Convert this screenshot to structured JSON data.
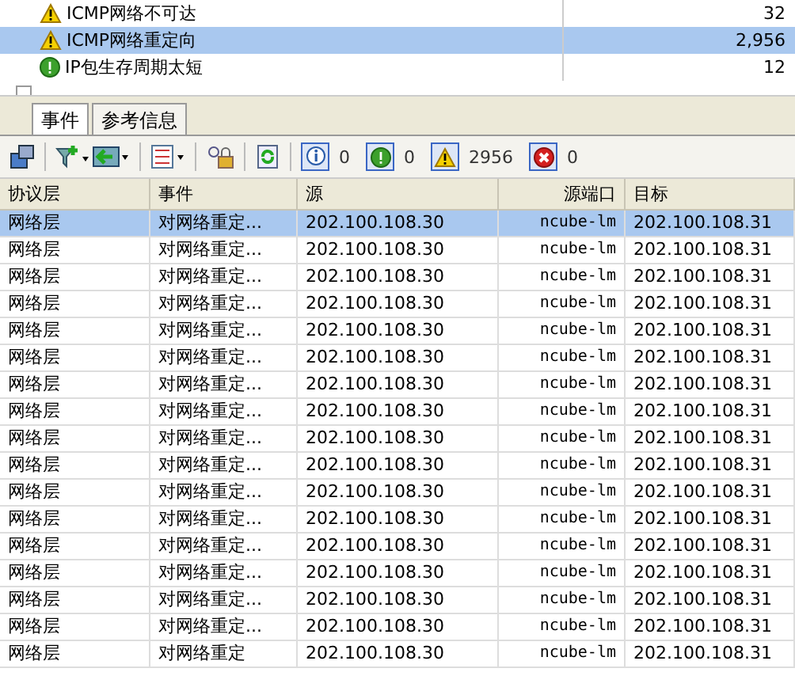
{
  "tree": [
    {
      "label": "ICMP网络不可达",
      "kind": "warning",
      "count": "32",
      "selected": false
    },
    {
      "label": "ICMP网络重定向",
      "kind": "warning",
      "count": "2,956",
      "selected": true
    },
    {
      "label": "IP包生存周期太短",
      "kind": "notice",
      "count": "12",
      "selected": false
    }
  ],
  "tabs": [
    {
      "label": "事件",
      "selected": true
    },
    {
      "label": "参考信息",
      "selected": false
    }
  ],
  "filters": [
    {
      "kind": "info",
      "count": "0"
    },
    {
      "kind": "notice",
      "count": "0"
    },
    {
      "kind": "warning",
      "count": "2956"
    },
    {
      "kind": "error",
      "count": "0"
    }
  ],
  "table": {
    "columns": [
      "协议层",
      "事件",
      "源",
      "源端口",
      "目标"
    ],
    "rows": [
      {
        "cells": [
          "网络层",
          "对网络重定...",
          "202.100.108.30",
          "ncube-lm",
          "202.100.108.31"
        ],
        "selected": true
      },
      {
        "cells": [
          "网络层",
          "对网络重定...",
          "202.100.108.30",
          "ncube-lm",
          "202.100.108.31"
        ],
        "selected": false
      },
      {
        "cells": [
          "网络层",
          "对网络重定...",
          "202.100.108.30",
          "ncube-lm",
          "202.100.108.31"
        ],
        "selected": false
      },
      {
        "cells": [
          "网络层",
          "对网络重定...",
          "202.100.108.30",
          "ncube-lm",
          "202.100.108.31"
        ],
        "selected": false
      },
      {
        "cells": [
          "网络层",
          "对网络重定...",
          "202.100.108.30",
          "ncube-lm",
          "202.100.108.31"
        ],
        "selected": false
      },
      {
        "cells": [
          "网络层",
          "对网络重定...",
          "202.100.108.30",
          "ncube-lm",
          "202.100.108.31"
        ],
        "selected": false
      },
      {
        "cells": [
          "网络层",
          "对网络重定...",
          "202.100.108.30",
          "ncube-lm",
          "202.100.108.31"
        ],
        "selected": false
      },
      {
        "cells": [
          "网络层",
          "对网络重定...",
          "202.100.108.30",
          "ncube-lm",
          "202.100.108.31"
        ],
        "selected": false
      },
      {
        "cells": [
          "网络层",
          "对网络重定...",
          "202.100.108.30",
          "ncube-lm",
          "202.100.108.31"
        ],
        "selected": false
      },
      {
        "cells": [
          "网络层",
          "对网络重定...",
          "202.100.108.30",
          "ncube-lm",
          "202.100.108.31"
        ],
        "selected": false
      },
      {
        "cells": [
          "网络层",
          "对网络重定...",
          "202.100.108.30",
          "ncube-lm",
          "202.100.108.31"
        ],
        "selected": false
      },
      {
        "cells": [
          "网络层",
          "对网络重定...",
          "202.100.108.30",
          "ncube-lm",
          "202.100.108.31"
        ],
        "selected": false
      },
      {
        "cells": [
          "网络层",
          "对网络重定...",
          "202.100.108.30",
          "ncube-lm",
          "202.100.108.31"
        ],
        "selected": false
      },
      {
        "cells": [
          "网络层",
          "对网络重定...",
          "202.100.108.30",
          "ncube-lm",
          "202.100.108.31"
        ],
        "selected": false
      },
      {
        "cells": [
          "网络层",
          "对网络重定...",
          "202.100.108.30",
          "ncube-lm",
          "202.100.108.31"
        ],
        "selected": false
      },
      {
        "cells": [
          "网络层",
          "对网络重定...",
          "202.100.108.30",
          "ncube-lm",
          "202.100.108.31"
        ],
        "selected": false
      },
      {
        "cells": [
          "网络层",
          "对网络重定",
          "202.100.108.30",
          "ncube-lm",
          "202.100.108.31"
        ],
        "selected": false
      }
    ]
  }
}
